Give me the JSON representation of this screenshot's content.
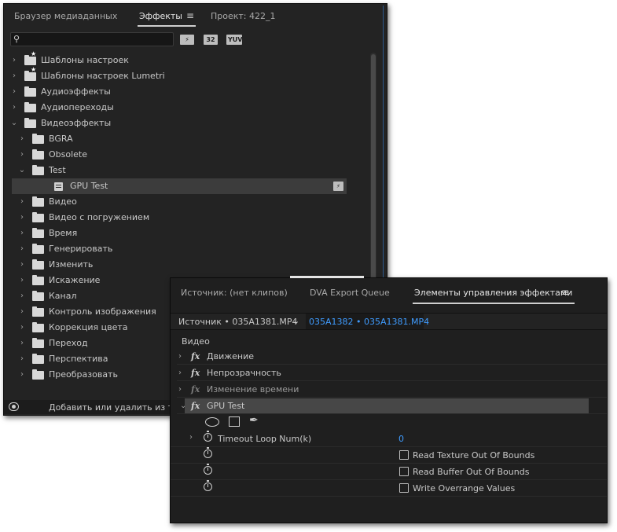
{
  "effects_panel": {
    "tabs": {
      "media_browser": "Браузер медиаданных",
      "effects": "Эффекты",
      "menu_glyph": "≡",
      "project": "Проект: 422_1"
    },
    "toolbar": {
      "search_value": "",
      "badges": [
        "accelerated",
        "32",
        "YUV"
      ]
    },
    "tree": [
      {
        "label": "Шаблоны настроек",
        "icon": "preset-folder-icon",
        "level": 0,
        "expanded": false
      },
      {
        "label": "Шаблоны настроек Lumetri",
        "icon": "preset-folder-icon",
        "level": 0,
        "expanded": false
      },
      {
        "label": "Аудиоэффекты",
        "icon": "folder-icon",
        "level": 0,
        "expanded": false
      },
      {
        "label": "Аудиопереходы",
        "icon": "folder-icon",
        "level": 0,
        "expanded": false
      },
      {
        "label": "Видеоэффекты",
        "icon": "folder-icon",
        "level": 0,
        "expanded": true
      },
      {
        "label": "BGRA",
        "icon": "folder-icon",
        "level": 1,
        "expanded": false
      },
      {
        "label": "Obsolete",
        "icon": "folder-icon",
        "level": 1,
        "expanded": false
      },
      {
        "label": "Test",
        "icon": "folder-icon",
        "level": 1,
        "expanded": true
      },
      {
        "label": "GPU Test",
        "icon": "effect-icon",
        "level": 2,
        "selected": true,
        "badge": "accelerated"
      },
      {
        "label": "Видео",
        "icon": "folder-icon",
        "level": 1,
        "expanded": false
      },
      {
        "label": "Видео с погружением",
        "icon": "folder-icon",
        "level": 1,
        "expanded": false
      },
      {
        "label": "Время",
        "icon": "folder-icon",
        "level": 1,
        "expanded": false
      },
      {
        "label": "Генерировать",
        "icon": "folder-icon",
        "level": 1,
        "expanded": false
      },
      {
        "label": "Изменить",
        "icon": "folder-icon",
        "level": 1,
        "expanded": false
      },
      {
        "label": "Искажение",
        "icon": "folder-icon",
        "level": 1,
        "expanded": false
      },
      {
        "label": "Канал",
        "icon": "folder-icon",
        "level": 1,
        "expanded": false
      },
      {
        "label": "Контроль изображения",
        "icon": "folder-icon",
        "level": 1,
        "expanded": false
      },
      {
        "label": "Коррекция цвета",
        "icon": "folder-icon",
        "level": 1,
        "expanded": false
      },
      {
        "label": "Переход",
        "icon": "folder-icon",
        "level": 1,
        "expanded": false
      },
      {
        "label": "Перспектива",
        "icon": "folder-icon",
        "level": 1,
        "expanded": false
      },
      {
        "label": "Преобразовать",
        "icon": "folder-icon",
        "level": 1,
        "expanded": false
      }
    ],
    "footer_text": "Добавить или удалить из тек"
  },
  "controls_panel": {
    "tabs": {
      "source": "Источник: (нет клипов)",
      "dva": "DVA Export Queue",
      "effect_controls": "Элементы управления эффектами",
      "menu_glyph": "≡"
    },
    "source_clip": "Источник • 035A1381.MP4",
    "sequence_clip": "035A1382 • 035A1381.MP4",
    "section_label": "Видео",
    "effects": [
      {
        "label": "Движение",
        "dim": false
      },
      {
        "label": "Непрозрачность",
        "dim": false
      },
      {
        "label": "Изменение времени",
        "dim": true
      },
      {
        "label": "GPU Test",
        "dim": false,
        "expanded": true
      }
    ],
    "params": {
      "timeout_label": "Timeout Loop Num(k)",
      "timeout_value": "0",
      "read_texture": "Read Texture Out Of Bounds",
      "read_buffer": "Read Buffer Out Of Bounds",
      "write_overrange": "Write Overrange Values"
    }
  },
  "colors": {
    "panel_bg": "#232323",
    "accent_blue": "#3f9cff",
    "selected_row": "#3c3c3c"
  }
}
